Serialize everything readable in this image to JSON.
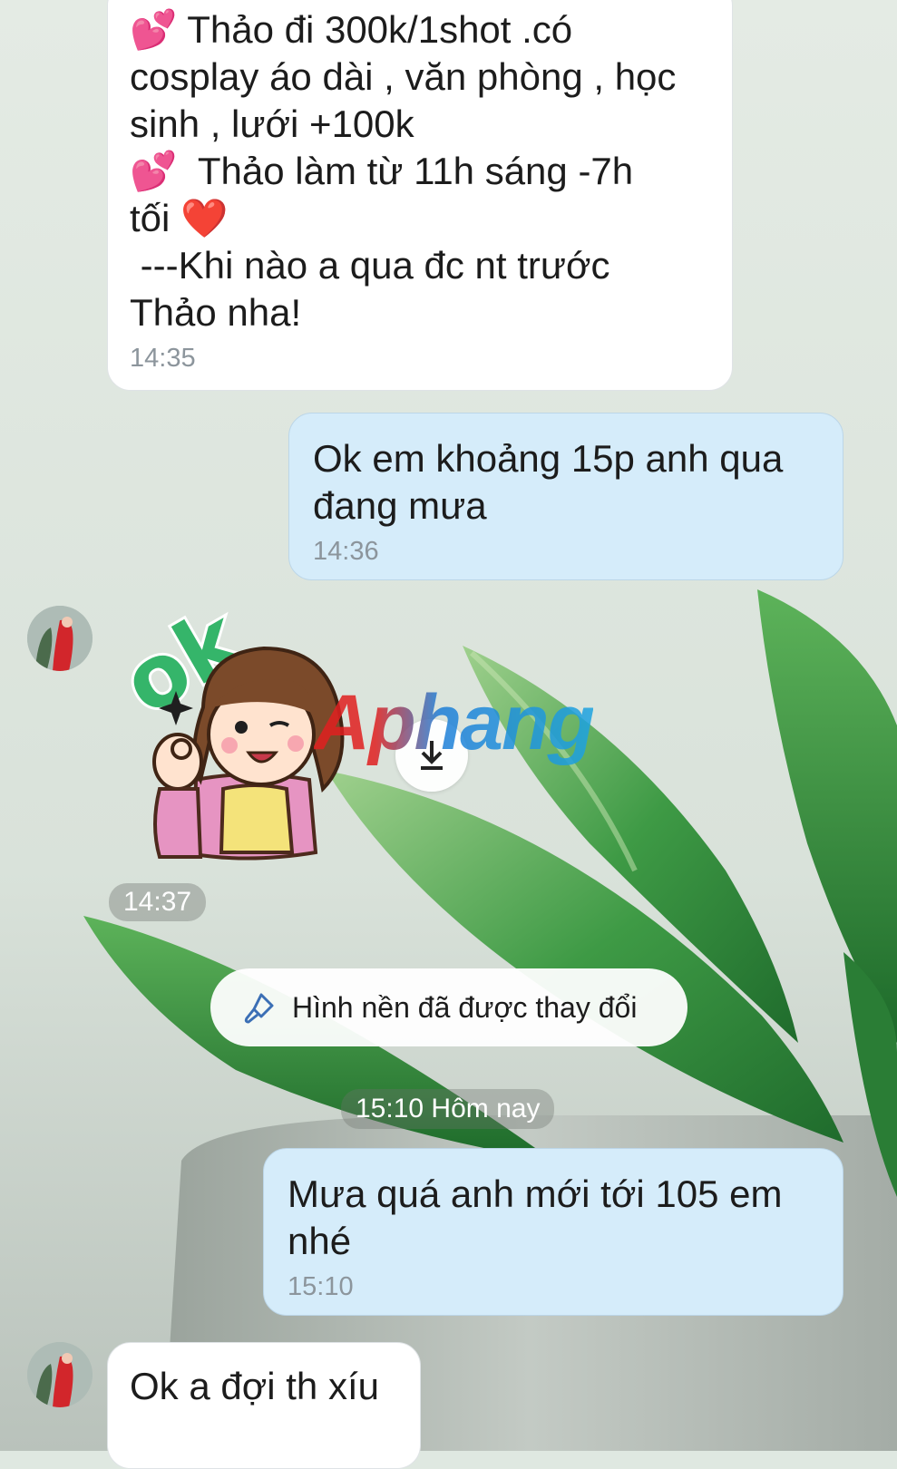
{
  "messages": [
    {
      "id": "m1",
      "direction": "incoming",
      "text_lines": [
        {
          "emoji": "💕",
          "text": " Thảo đi 300k/1shot .có"
        },
        {
          "emoji": "",
          "text": "cosplay áo dài , văn phòng , học"
        },
        {
          "emoji": "",
          "text": "sinh , lưới +100k"
        },
        {
          "emoji": "💕",
          "text": "  Thảo làm từ 11h sáng -7h"
        },
        {
          "emoji": "",
          "text": "tối ❤️"
        },
        {
          "emoji": "",
          "text": " ---Khi nào a qua đc nt trước"
        },
        {
          "emoji": "",
          "text": "Thảo nha!"
        }
      ],
      "time": "14:35"
    },
    {
      "id": "m2",
      "direction": "outgoing",
      "text": "Ok em khoảng 15p anh qua đang mưa",
      "time": "14:36"
    },
    {
      "id": "m3",
      "direction": "incoming",
      "type": "sticker",
      "sticker_text": "ok",
      "time": "14:37"
    },
    {
      "id": "m4",
      "direction": "outgoing",
      "text": "Mưa quá anh mới tới 105 em nhé",
      "time": "15:10"
    },
    {
      "id": "m5",
      "direction": "incoming",
      "text": "Ok a đợi th xíu"
    }
  ],
  "system_notice": {
    "icon": "paint-brush-icon",
    "text": "Hình nền đã được thay đổi"
  },
  "date_separator": "15:10 Hôm nay",
  "watermark": "Aphang",
  "colors": {
    "incoming_bubble": "#ffffff",
    "outgoing_bubble": "#d5ecfa",
    "time_text": "#8c959c",
    "wallpaper_leaf": "#2f8a3a",
    "sticker_ok": "#35b56a"
  }
}
